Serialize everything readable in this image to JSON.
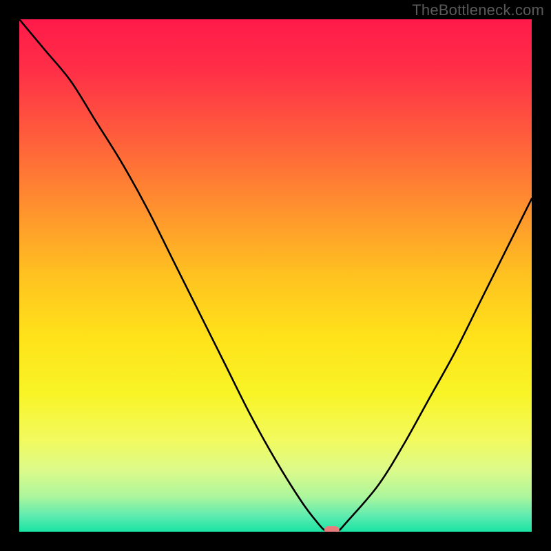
{
  "watermark": "TheBottleneck.com",
  "colors": {
    "gradient_stops": [
      {
        "offset": 0.0,
        "color": "#ff1a4a"
      },
      {
        "offset": 0.1,
        "color": "#ff2f47"
      },
      {
        "offset": 0.22,
        "color": "#ff5a3d"
      },
      {
        "offset": 0.35,
        "color": "#ff8a30"
      },
      {
        "offset": 0.5,
        "color": "#ffc220"
      },
      {
        "offset": 0.62,
        "color": "#ffe21a"
      },
      {
        "offset": 0.73,
        "color": "#f8f426"
      },
      {
        "offset": 0.82,
        "color": "#f2fa5e"
      },
      {
        "offset": 0.88,
        "color": "#dcfa8a"
      },
      {
        "offset": 0.93,
        "color": "#aef69c"
      },
      {
        "offset": 0.97,
        "color": "#5cebb0"
      },
      {
        "offset": 1.0,
        "color": "#19e4a3"
      }
    ],
    "curve": "#000000",
    "marker": "#e77c7c",
    "background": "#000000"
  },
  "chart_data": {
    "type": "line",
    "title": "",
    "xlabel": "",
    "ylabel": "",
    "xlim": [
      0,
      100
    ],
    "ylim": [
      0,
      100
    ],
    "series": [
      {
        "name": "bottleneck-curve",
        "x": [
          0,
          5,
          10,
          15,
          20,
          25,
          30,
          35,
          40,
          45,
          50,
          55,
          58,
          60,
          62,
          64,
          70,
          75,
          80,
          85,
          90,
          95,
          100
        ],
        "y": [
          100,
          94,
          88,
          80,
          72,
          63,
          53,
          43,
          33,
          23,
          14,
          6,
          2,
          0,
          0,
          2,
          9,
          17,
          26,
          35,
          45,
          55,
          65
        ]
      }
    ],
    "annotations": [
      {
        "type": "marker",
        "x": 61,
        "y": 0,
        "label": "optimal-point"
      }
    ]
  }
}
